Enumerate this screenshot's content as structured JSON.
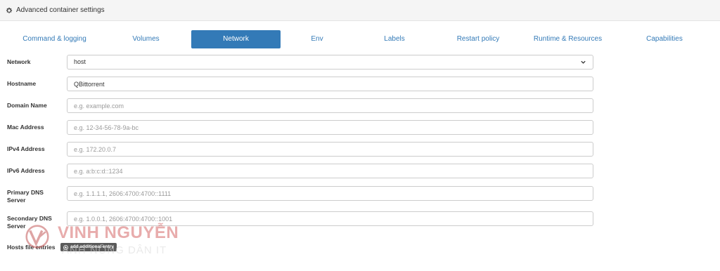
{
  "panel": {
    "title": "Advanced container settings",
    "icon": "gear-icon"
  },
  "tabs": [
    {
      "label": "Command & logging",
      "active": false
    },
    {
      "label": "Volumes",
      "active": false
    },
    {
      "label": "Network",
      "active": true
    },
    {
      "label": "Env",
      "active": false
    },
    {
      "label": "Labels",
      "active": false
    },
    {
      "label": "Restart policy",
      "active": false
    },
    {
      "label": "Runtime & Resources",
      "active": false
    },
    {
      "label": "Capabilities",
      "active": false
    }
  ],
  "form": {
    "network": {
      "label": "Network",
      "value": "host"
    },
    "hostname": {
      "label": "Hostname",
      "value": "QBittorrent",
      "placeholder": ""
    },
    "domain_name": {
      "label": "Domain Name",
      "value": "",
      "placeholder": "e.g. example.com"
    },
    "mac_address": {
      "label": "Mac Address",
      "value": "",
      "placeholder": "e.g. 12-34-56-78-9a-bc"
    },
    "ipv4_address": {
      "label": "IPv4 Address",
      "value": "",
      "placeholder": "e.g. 172.20.0.7"
    },
    "ipv6_address": {
      "label": "IPv6 Address",
      "value": "",
      "placeholder": "e.g. a:b:c:d::1234"
    },
    "primary_dns": {
      "label_line1": "Primary DNS",
      "label_line2": "Server",
      "value": "",
      "placeholder": "e.g. 1.1.1.1, 2606:4700:4700::1111"
    },
    "secondary_dns": {
      "label_line1": "Secondary DNS",
      "label_line2": "Server",
      "value": "",
      "placeholder": "e.g. 1.0.0.1, 2606:4700:4700::1001"
    },
    "hosts_file": {
      "label": "Hosts file entries",
      "add_button_label": "add additional entry",
      "add_icon": "plus-circle-icon"
    }
  },
  "watermark": {
    "title": "VINH NGUYỄN",
    "subtitle": "ANH NÔNG DÂN IT",
    "color": "#d66a6a"
  },
  "colors": {
    "accent": "#337ab7",
    "header_bg": "#f5f5f5",
    "button_dark": "#5a5a5a"
  }
}
